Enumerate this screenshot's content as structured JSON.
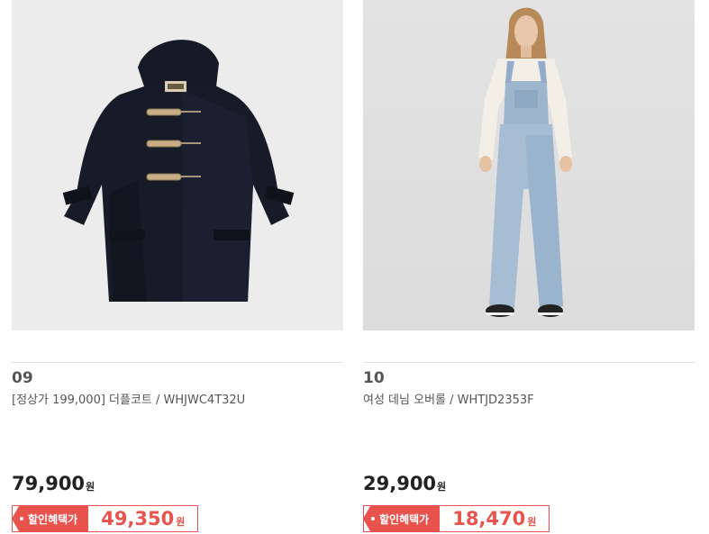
{
  "products": [
    {
      "rank": "09",
      "name": "[정상가 199,000] 더플코트 / WHJWC4T32U",
      "price": "79,900",
      "price_unit": "원",
      "sale_label": "할인혜택가",
      "sale_price": "49,350",
      "sale_unit": "원",
      "image": "navy-duffle-coat-photo"
    },
    {
      "rank": "10",
      "name": "여성 데님 오버롤 / WHTJD2353F",
      "price": "29,900",
      "price_unit": "원",
      "sale_label": "할인혜택가",
      "sale_price": "18,470",
      "sale_unit": "원",
      "image": "woman-denim-overalls-photo"
    }
  ],
  "colors": {
    "accent": "#e8534d",
    "text": "#222222",
    "muted": "#555555"
  }
}
